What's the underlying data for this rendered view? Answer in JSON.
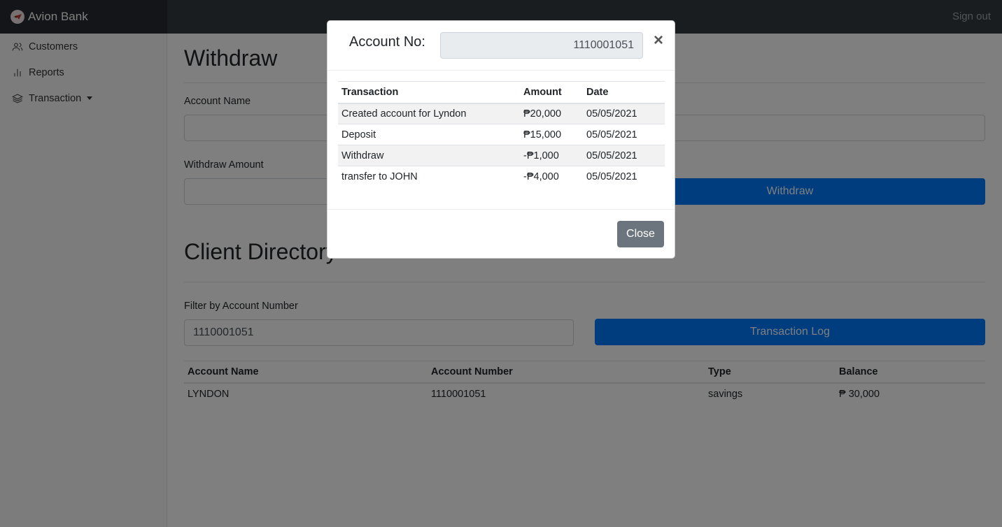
{
  "navbar": {
    "brand": "Avion Bank",
    "signout": "Sign out"
  },
  "sidebar": {
    "items": [
      {
        "label": "Customers",
        "icon": "users-icon"
      },
      {
        "label": "Reports",
        "icon": "bar-chart-icon"
      },
      {
        "label": "Transaction",
        "icon": "layers-icon"
      }
    ]
  },
  "withdraw": {
    "title": "Withdraw",
    "account_name_label": "Account Name",
    "amount_label": "Withdraw Amount",
    "button": "Withdraw"
  },
  "directory": {
    "title": "Client Directory",
    "filter_label": "Filter by Account Number",
    "filter_value": "1110001051",
    "button": "Transaction Log",
    "headers": [
      "Account Name",
      "Account Number",
      "Type",
      "Balance"
    ],
    "rows": [
      [
        "LYNDON",
        "1110001051",
        "savings",
        "₱ 30,000"
      ]
    ]
  },
  "modal": {
    "title": "Account No:",
    "account_no": "1110001051",
    "close_x": "×",
    "headers": [
      "Transaction",
      "Amount",
      "Date"
    ],
    "rows": [
      [
        "Created account for Lyndon",
        "₱20,000",
        "05/05/2021"
      ],
      [
        "Deposit",
        "₱15,000",
        "05/05/2021"
      ],
      [
        "Withdraw",
        "-₱1,000",
        "05/05/2021"
      ],
      [
        "transfer to JOHN",
        "-₱4,000",
        "05/05/2021"
      ]
    ],
    "close_button": "Close"
  },
  "colors": {
    "primary": "#007bff",
    "secondary": "#6c757d",
    "navbar": "#343a40"
  }
}
